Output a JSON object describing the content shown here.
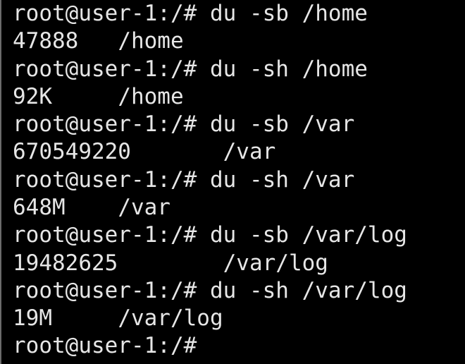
{
  "terminal": {
    "lines": [
      {
        "kind": "prompt",
        "text": "root@user-1:/# du -sb /home"
      },
      {
        "kind": "output",
        "text": "47888\t/home"
      },
      {
        "kind": "prompt",
        "text": "root@user-1:/# du -sh /home"
      },
      {
        "kind": "output",
        "text": "92K\t/home"
      },
      {
        "kind": "prompt",
        "text": "root@user-1:/# du -sb /var"
      },
      {
        "kind": "output",
        "text": "670549220\t/var"
      },
      {
        "kind": "prompt",
        "text": "root@user-1:/# du -sh /var"
      },
      {
        "kind": "output",
        "text": "648M\t/var"
      },
      {
        "kind": "prompt",
        "text": "root@user-1:/# du -sb /var/log"
      },
      {
        "kind": "output",
        "text": "19482625\t/var/log"
      },
      {
        "kind": "prompt",
        "text": "root@user-1:/# du -sh /var/log"
      },
      {
        "kind": "output",
        "text": "19M\t/var/log"
      },
      {
        "kind": "prompt",
        "text": "root@user-1:/#"
      }
    ],
    "colors": {
      "background": "#000000",
      "foreground": "#e6e6e6",
      "border": "#6b6b6b"
    }
  }
}
